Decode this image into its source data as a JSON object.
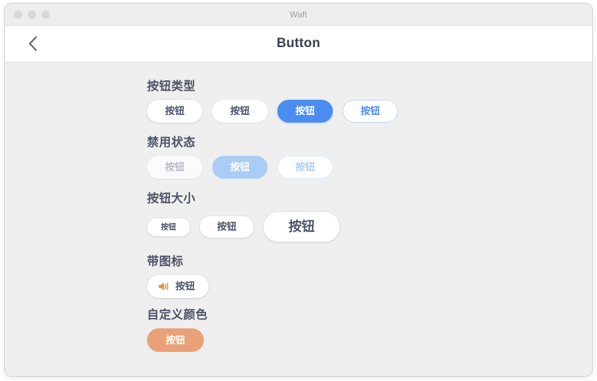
{
  "window": {
    "title": "Waft",
    "traffic_lights": [
      "close",
      "minimize",
      "zoom"
    ]
  },
  "navbar": {
    "back_icon": "chevron-left-icon",
    "title": "Button"
  },
  "sections": [
    {
      "id": "button-types",
      "title": "按钮类型",
      "buttons": [
        {
          "label": "按钮",
          "variant": "default"
        },
        {
          "label": "按钮",
          "variant": "plain"
        },
        {
          "label": "按钮",
          "variant": "primary"
        },
        {
          "label": "按钮",
          "variant": "outline"
        }
      ]
    },
    {
      "id": "disabled-state",
      "title": "禁用状态",
      "buttons": [
        {
          "label": "按钮",
          "variant": "disabled-default"
        },
        {
          "label": "按钮",
          "variant": "disabled-primary"
        },
        {
          "label": "按钮",
          "variant": "disabled-outline"
        }
      ]
    },
    {
      "id": "button-size",
      "title": "按钮大小",
      "buttons": [
        {
          "label": "按钮",
          "size": "small"
        },
        {
          "label": "按钮",
          "size": "medium"
        },
        {
          "label": "按钮",
          "size": "large"
        }
      ]
    },
    {
      "id": "with-icon",
      "title": "带图标",
      "buttons": [
        {
          "label": "按钮",
          "icon": "speaker-icon"
        }
      ]
    },
    {
      "id": "custom-color",
      "title": "自定义颜色",
      "buttons": [
        {
          "label": "按钮",
          "variant": "custom"
        }
      ]
    }
  ],
  "colors": {
    "primary_blue": "#4a8cf0",
    "outline_blue": "#b9d3f7",
    "disabled_blue": "#a9cdf6",
    "custom_orange": "#e9a178",
    "icon_orange": "#e8923a",
    "text_slate": "#4d5366",
    "content_bg": "#efefef",
    "navbar_bg": "#ffffff",
    "titlebar_bg": "#ededed"
  }
}
